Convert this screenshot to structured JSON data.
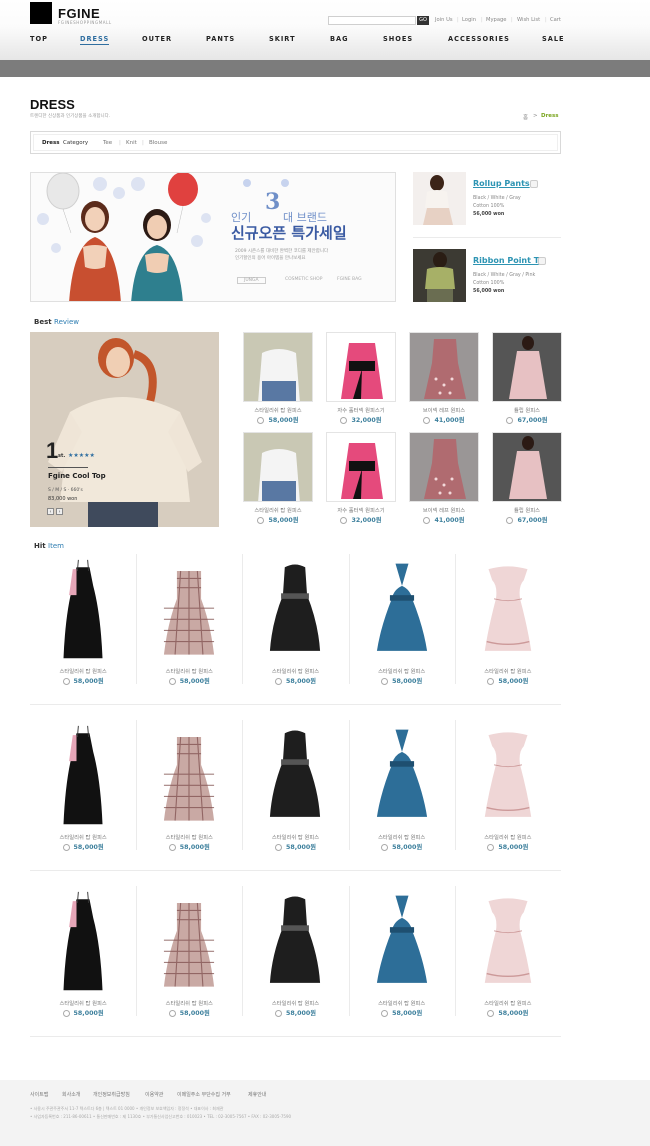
{
  "brand": {
    "name": "FGINE",
    "tagline": "FGINESHOPPINGMALL"
  },
  "util_links": [
    "Join Us",
    "Login",
    "Mypage",
    "Wish List",
    "Cart"
  ],
  "search": {
    "go": "GO"
  },
  "nav": [
    "TOP",
    "DRESS",
    "OUTER",
    "PANTS",
    "SKIRT",
    "BAG",
    "SHOES",
    "ACCESSORIES",
    "SALE"
  ],
  "nav_active": "DRESS",
  "page": {
    "title": "DRESS",
    "subtitle": "트렌디한 신상품과 인기상품을 소개합니다.",
    "crumb_home": "홈",
    "crumb_sep": ">",
    "crumb_current": "Dress"
  },
  "category": {
    "bold": "Dress",
    "label": "Category",
    "items": [
      "Tee",
      "Knit",
      "Blouse"
    ],
    "sep": "|"
  },
  "banner": {
    "pre": "인기",
    "number": "3",
    "post": "대 브랜드",
    "headline": "신규오픈 특가세일",
    "desc1": "2009 시즌스를 대비한 완벽한 코디를 제안합니다",
    "desc2": "인기할인의 용어 아이템을 만나보세요",
    "brands": [
      "JUNGA",
      "COSMETIC SHOP",
      "FGINE BAG"
    ]
  },
  "side_products": [
    {
      "name": "Rollup Pants",
      "colors": "Black / White / Gray",
      "material": "Cotton 100%",
      "price": "56,000 won"
    },
    {
      "name": "Ribbon Point T",
      "colors": "Black / White / Gray / Pink",
      "material": "Cotton 100%",
      "price": "56,000 won"
    }
  ],
  "best_review": {
    "title_bold": "Best",
    "title_rest": "Review",
    "rank": "1",
    "rank_suffix": "st.",
    "stars": "★★★★★",
    "product": "Fgine Cool Top",
    "sizes": "S  /  M  /  S  ·  660's",
    "price": "83,000 won",
    "items": [
      {
        "name": "스타일리쉬 탑 원피스",
        "price": "58,000원"
      },
      {
        "name": "자수 홀터넥 원피스기",
        "price": "32,000원"
      },
      {
        "name": "브이넥 레프 원피스",
        "price": "41,000원"
      },
      {
        "name": "튤립 원피스",
        "price": "67,000원"
      },
      {
        "name": "스타일리쉬 탑 원피스",
        "price": "58,000원"
      },
      {
        "name": "자수 홀터넥 원피스기",
        "price": "32,000원"
      },
      {
        "name": "브이넥 레프 원피스",
        "price": "41,000원"
      },
      {
        "name": "튤립 원피스",
        "price": "67,000원"
      }
    ]
  },
  "hit_item": {
    "title_bold": "Hit",
    "title_rest": "Item",
    "rows": [
      [
        {
          "name": "스타일리쉬 탑 원피스",
          "price": "58,000원"
        },
        {
          "name": "스타일리쉬 탑 원피스",
          "price": "58,000원"
        },
        {
          "name": "스타일리쉬 탑 원피스",
          "price": "58,000원"
        },
        {
          "name": "스타일리쉬 탑 원피스",
          "price": "58,000원"
        },
        {
          "name": "스타일리쉬 탑 원피스",
          "price": "58,000원"
        }
      ],
      [
        {
          "name": "스타일리쉬 탑 원피스",
          "price": "58,000원"
        },
        {
          "name": "스타일리쉬 탑 원피스",
          "price": "58,000원"
        },
        {
          "name": "스타일리쉬 탑 원피스",
          "price": "58,000원"
        },
        {
          "name": "스타일리쉬 탑 원피스",
          "price": "58,000원"
        },
        {
          "name": "스타일리쉬 탑 원피스",
          "price": "58,000원"
        }
      ],
      [
        {
          "name": "스타일리쉬 탑 원피스",
          "price": "58,000원"
        },
        {
          "name": "스타일리쉬 탑 원피스",
          "price": "58,000원"
        },
        {
          "name": "스타일리쉬 탑 원피스",
          "price": "58,000원"
        },
        {
          "name": "스타일리쉬 탑 원피스",
          "price": "58,000원"
        },
        {
          "name": "스타일리쉬 탑 원피스",
          "price": "58,000원"
        }
      ]
    ]
  },
  "footer": {
    "links": [
      "사이트맵",
      "회사소개",
      "개인정보취급방침",
      "이용약관",
      "이메일주소 무단수집 거부",
      "제휴안내"
    ],
    "info1": "• 사용시 주관주관주서 11-7 텍스트다 6층 | 텍스트 01 0000   • 개인정보 보호책임자 : 정정석   • 대표이사 : 최재관",
    "info2": "• 사업자등록번호 : 211-86-00611   • 통신판매번호 : 제 1130호   • 부가통신사업신고번호 : 010023   • TEL : 02-3005-7567   • FAX : 02-3005-7590"
  },
  "colors": {
    "accent": "#2f6ea0",
    "link": "#2d94b3",
    "price": "#3c7f9c",
    "bar": "#7c7c7c"
  }
}
